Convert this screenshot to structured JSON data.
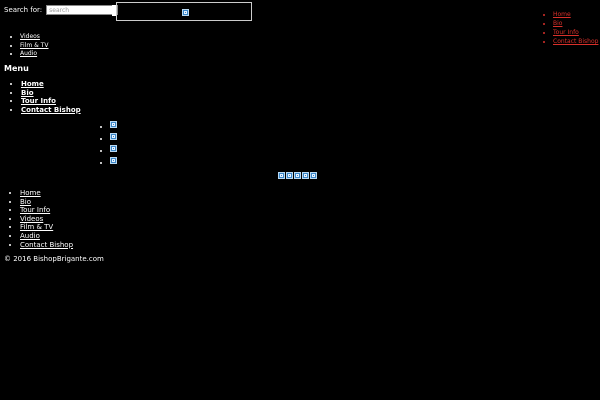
{
  "search": {
    "label": "Search for:",
    "placeholder": "search",
    "value": ""
  },
  "header": {
    "logo_icon": "image-placeholder-icon"
  },
  "top_right_nav": {
    "items": [
      {
        "label": "Home"
      },
      {
        "label": "Bio"
      },
      {
        "label": "Tour Info"
      },
      {
        "label": "Contact Bishop"
      }
    ]
  },
  "sub_nav": {
    "items": [
      {
        "label": "Videos"
      },
      {
        "label": "Film & TV"
      },
      {
        "label": "Audio"
      }
    ]
  },
  "menu": {
    "title": "Menu",
    "items": [
      {
        "label": "Home"
      },
      {
        "label": "Bio"
      },
      {
        "label": "Tour Info"
      },
      {
        "label": "Contact Bishop"
      }
    ]
  },
  "social_icons": {
    "column": [
      "image-placeholder-icon",
      "image-placeholder-icon",
      "image-placeholder-icon",
      "image-placeholder-icon"
    ],
    "row": [
      "image-placeholder-icon",
      "image-placeholder-icon",
      "image-placeholder-icon",
      "image-placeholder-icon",
      "image-placeholder-icon"
    ]
  },
  "footer_nav": {
    "items": [
      {
        "label": "Home"
      },
      {
        "label": "Bio"
      },
      {
        "label": "Tour Info"
      },
      {
        "label": "Videos"
      },
      {
        "label": "Film & TV"
      },
      {
        "label": "Audio"
      },
      {
        "label": "Contact Bishop"
      }
    ]
  },
  "footer": {
    "copyright": "© 2016 BishopBrigante.com"
  },
  "colors": {
    "background": "#000000",
    "text": "#ffffff",
    "accent_link": "#d9302a"
  }
}
